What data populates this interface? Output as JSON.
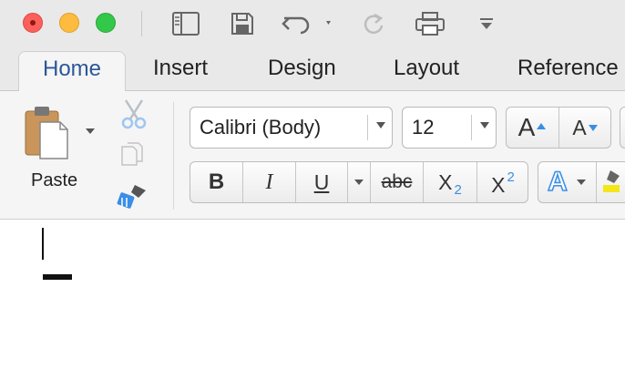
{
  "titlebar": {
    "buttons": [
      "close",
      "minimize",
      "zoom"
    ],
    "quick_access": [
      "sidebar-toggle-icon",
      "save-icon",
      "undo-icon",
      "redo-icon",
      "print-icon",
      "customize-toolbar-icon"
    ]
  },
  "tabs": {
    "active": "Home",
    "items": [
      "Insert",
      "Design",
      "Layout",
      "Reference"
    ]
  },
  "ribbon": {
    "paste_label": "Paste",
    "font_name": "Calibri (Body)",
    "font_size": "12",
    "grow_font": "A",
    "shrink_font": "A",
    "bold": "B",
    "italic": "I",
    "underline": "U",
    "strikethrough": "abc",
    "subscript": "X",
    "subscript_sub": "2",
    "superscript": "X",
    "superscript_sup": "2",
    "text_effects": "A"
  },
  "colors": {
    "accent": "#2b5797",
    "icon_blue": "#3a8ee6",
    "highlighter_yellow": "#f5e61a"
  }
}
